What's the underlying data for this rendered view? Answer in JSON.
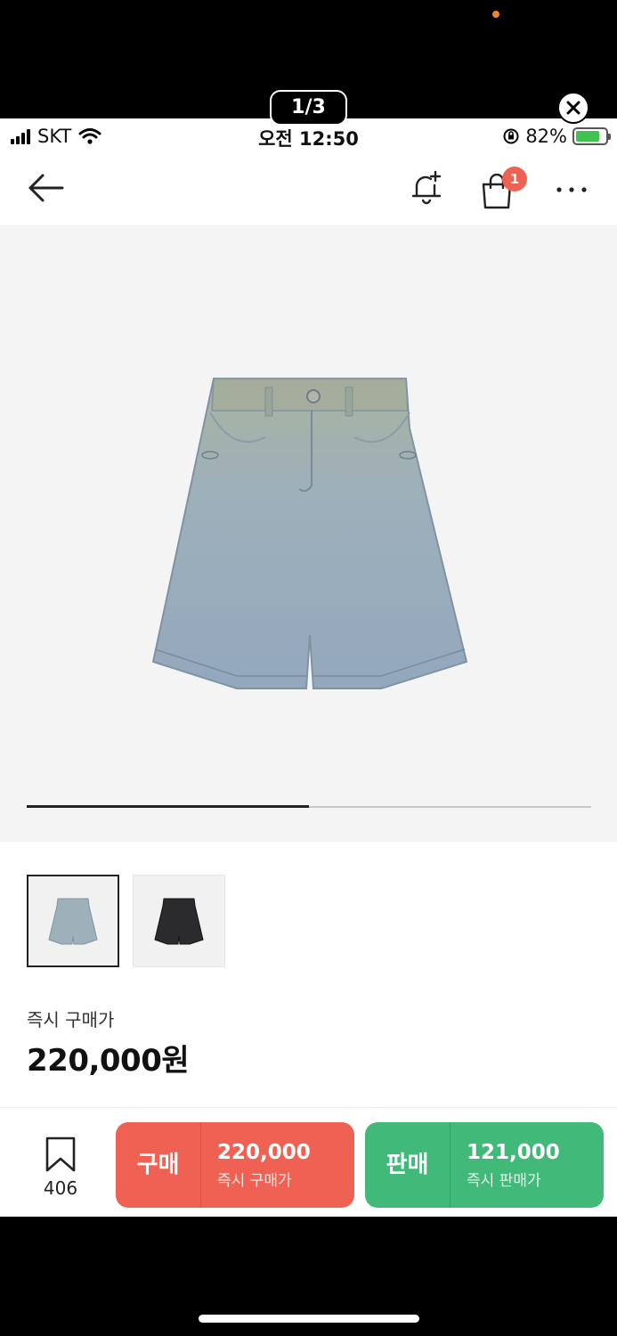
{
  "viewer": {
    "page_counter": "1/3",
    "close_icon": "close-circle-icon"
  },
  "status_bar": {
    "carrier": "SKT",
    "time": "오전 12:50",
    "battery_percent": "82%",
    "battery_level": 0.82,
    "icons": [
      "signal-icon",
      "wifi-icon",
      "orientation-lock-icon",
      "battery-charging-icon"
    ]
  },
  "nav": {
    "back_icon": "arrow-left-icon",
    "alert_icon": "bell-plus-icon",
    "cart_icon": "shopping-bag-icon",
    "cart_badge": "1",
    "more_icon": "more-horizontal-icon"
  },
  "gallery": {
    "image": "light-wash-denim-shorts",
    "progress": 0.5
  },
  "thumbnails": [
    {
      "name": "light-wash-denim-shorts",
      "selected": true
    },
    {
      "name": "black-denim-shorts",
      "selected": false
    }
  ],
  "price": {
    "label": "즉시 구매가",
    "value": "220,000원"
  },
  "bottom_bar": {
    "bookmark_icon": "bookmark-icon",
    "bookmark_count": "406",
    "buy": {
      "label": "구매",
      "amount": "220,000",
      "sub": "즉시 구매가"
    },
    "sell": {
      "label": "판매",
      "amount": "121,000",
      "sub": "즉시 판매가"
    }
  },
  "colors": {
    "buy": "#ef6253",
    "sell": "#41b979",
    "badge": "#ef6253",
    "battery": "#3fc24f"
  }
}
